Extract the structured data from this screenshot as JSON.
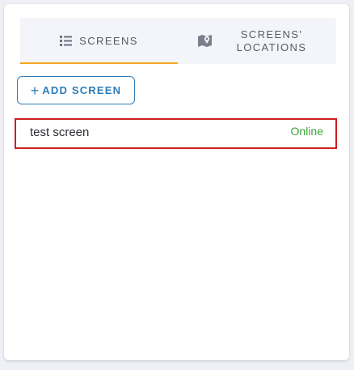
{
  "tabs": [
    {
      "label": "SCREENS",
      "icon": "list-icon",
      "active": true
    },
    {
      "label": "SCREENS' LOCATIONS",
      "icon": "map-icon",
      "active": false
    }
  ],
  "actions": {
    "add_screen_label": "ADD SCREEN",
    "add_screen_icon": "plus-icon"
  },
  "screens": [
    {
      "name": "test screen",
      "status": "Online",
      "selected": true
    }
  ],
  "colors": {
    "accent": "#f5a623",
    "primary": "#2e7db8",
    "online": "#3aa635",
    "selection_border": "#cc1f1f"
  }
}
